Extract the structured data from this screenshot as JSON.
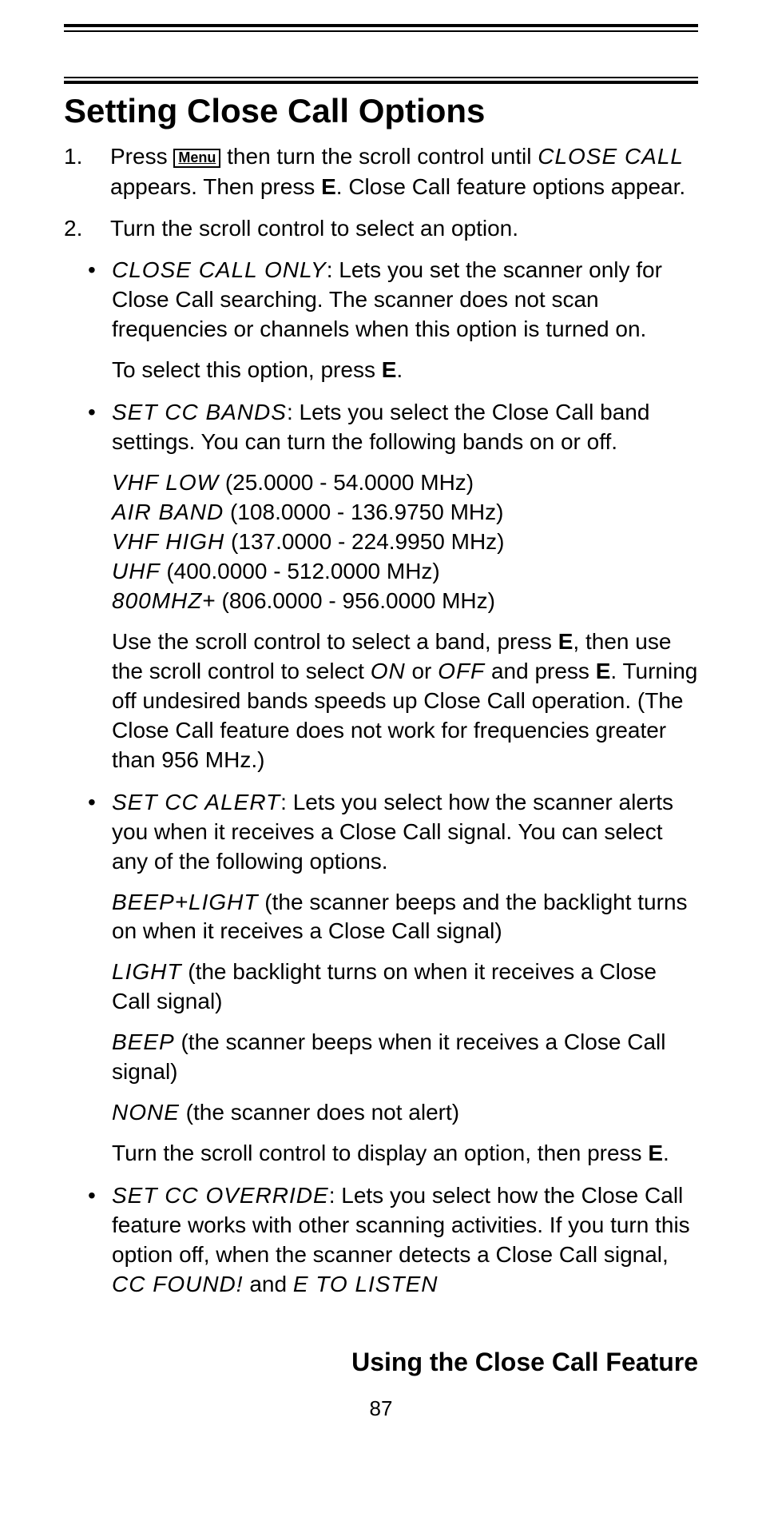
{
  "heading": "Setting Close Call Options",
  "step1": {
    "num": "1.",
    "pre": "Press ",
    "menu_key": "Menu",
    "mid": " then turn the scroll control until ",
    "lcd": "CLOSE CALL",
    "post1": " appears. Then press ",
    "e": "E",
    "post2": ". Close Call feature options appear."
  },
  "step2": {
    "num": "2.",
    "text": "Turn the scroll control to select an option."
  },
  "opt_cc_only": {
    "lcd": "CLOSE CALL ONLY",
    "desc": ": Lets you set the scanner only for Close Call searching. The scanner does not scan frequencies or channels when this option is turned on.",
    "select_pre": "To select this option, press ",
    "e": "E",
    "select_post": "."
  },
  "opt_cc_bands": {
    "lcd": "SET CC BANDS",
    "desc": ": Lets you select the Close Call band settings. You can turn the following bands on or off.",
    "bands": [
      {
        "lcd": "VHF LOW",
        "range": " (25.0000 - 54.0000 MHz)"
      },
      {
        "lcd": "AIR BAND",
        "range": " (108.0000 - 136.9750 MHz)"
      },
      {
        "lcd": "VHF HIGH",
        "range": " (137.0000 - 224.9950 MHz)"
      },
      {
        "lcd": "UHF",
        "range": " (400.0000 - 512.0000 MHz)"
      },
      {
        "lcd": "800MHZ",
        "range": "+ (806.0000 - 956.0000 MHz)"
      }
    ],
    "use_pre": "Use the scroll control to select a band, press ",
    "e1": "E",
    "use_mid1": ", then use the scroll control to select ",
    "on": "ON",
    "or": " or ",
    "off": "OFF",
    "use_mid2": " and press ",
    "e2": "E",
    "use_post": ". Turning off undesired bands speeds up Close Call operation. (The Close Call feature does not work for frequencies greater than 956 MHz.)"
  },
  "opt_cc_alert": {
    "lcd": "SET CC ALERT",
    "desc": ": Lets you select how the scanner alerts you when it receives a Close Call signal. You can select any of the following options.",
    "alerts": [
      {
        "lcd": "BEEP+LIGHT",
        "desc": " (the scanner beeps and the backlight turns on when it receives a Close Call signal)"
      },
      {
        "lcd": "LIGHT",
        "desc": " (the backlight turns on when it receives a Close Call signal)"
      },
      {
        "lcd": "BEEP",
        "desc": " (the scanner beeps when it receives a Close Call signal)"
      },
      {
        "lcd": "NONE",
        "desc": " (the scanner does not alert)"
      }
    ],
    "turn_pre": "Turn the scroll control to display an option, then press ",
    "e": "E",
    "turn_post": "."
  },
  "opt_cc_override": {
    "lcd": "SET CC OVERRIDE",
    "desc_pre": ": Lets you select how the Close Call feature works with other scanning activities. If you turn this option off, when the scanner detects a Close Call signal, ",
    "cc_found": "CC FOUND!",
    "and": " and ",
    "e_listen": "E TO LISTEN"
  },
  "footer_title": "Using the Close Call Feature",
  "page_number": "87"
}
